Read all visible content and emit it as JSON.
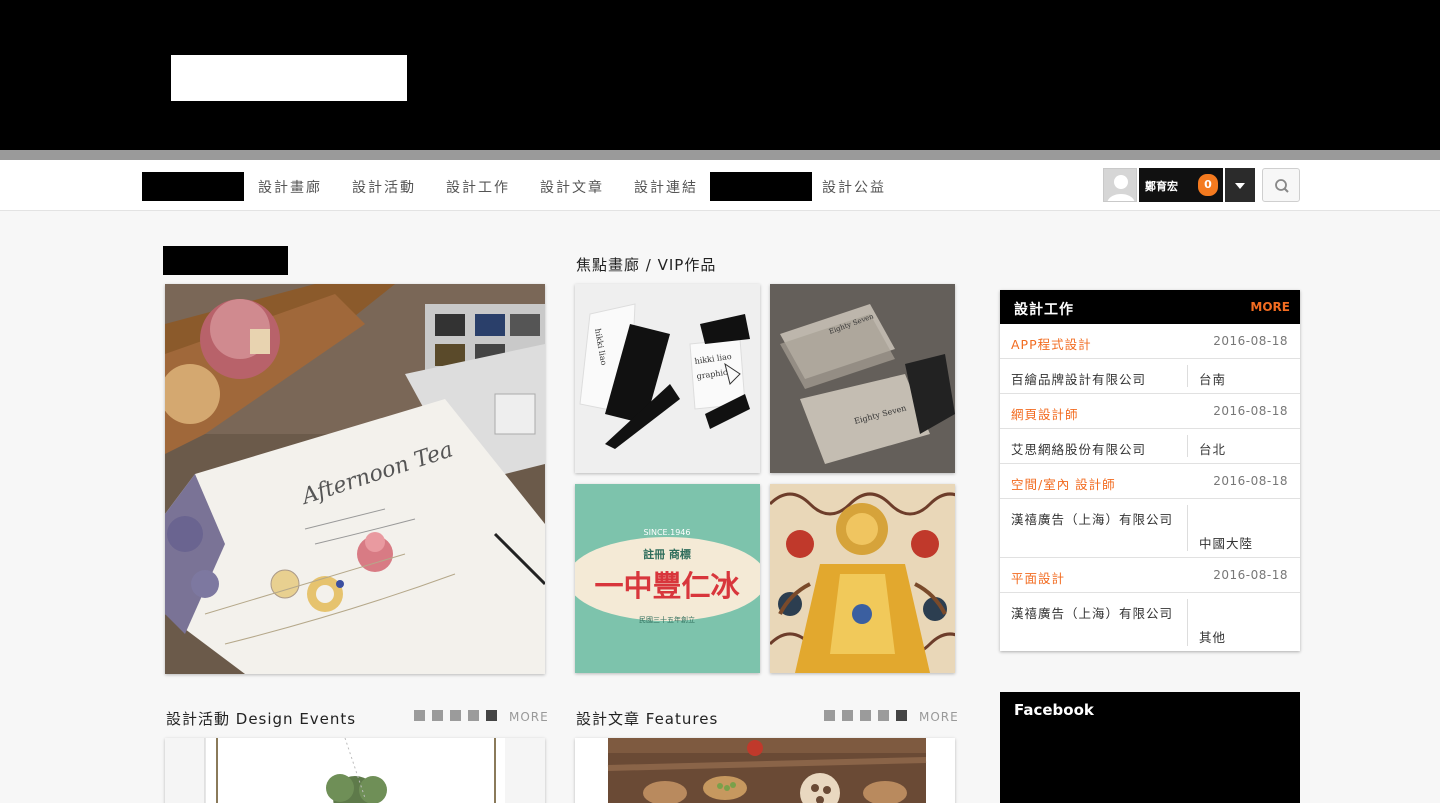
{
  "nav": {
    "items": [
      "設計畫廊",
      "設計活動",
      "設計工作",
      "設計文章",
      "設計連結",
      "設計公益"
    ]
  },
  "user": {
    "name": "鄭育宏",
    "notification_count": "0"
  },
  "focus_gallery": {
    "title": "焦點畫廊 / VIP作品",
    "card_texts": {
      "hikki_line1": "hikki liao",
      "hikki_line2": "graphic",
      "eighty_seven": "Eighty Seven",
      "since": "SINCE.1946",
      "registered": "註冊 商標",
      "brand": "一中豐仁冰",
      "founded": "民國三十五年創立"
    }
  },
  "main_image": {
    "script_text": "Afternoon Tea"
  },
  "jobs": {
    "title": "設計工作",
    "more": "MORE",
    "entries": [
      {
        "title": "APP程式設計",
        "date": "2016-08-18",
        "company": "百繪品牌設計有限公司",
        "location": "台南"
      },
      {
        "title": "網頁設計師",
        "date": "2016-08-18",
        "company": "艾思網絡股份有限公司",
        "location": "台北"
      },
      {
        "title": "空間/室內 設計師",
        "date": "2016-08-18",
        "company": "漢禧廣告（上海）有限公司",
        "location": "中國大陸"
      },
      {
        "title": "平面設計",
        "date": "2016-08-18",
        "company": "漢禧廣告（上海）有限公司",
        "location": "其他"
      }
    ]
  },
  "facebook": {
    "title": "Facebook"
  },
  "events": {
    "title": "設計活動 Design Events",
    "more": "MORE"
  },
  "features": {
    "title": "設計文章 Features",
    "more": "MORE"
  },
  "colors": {
    "accent": "#f26c21",
    "header_bg": "#000000"
  },
  "icons": [
    "user-avatar-icon",
    "chevron-down-icon",
    "search-icon"
  ]
}
